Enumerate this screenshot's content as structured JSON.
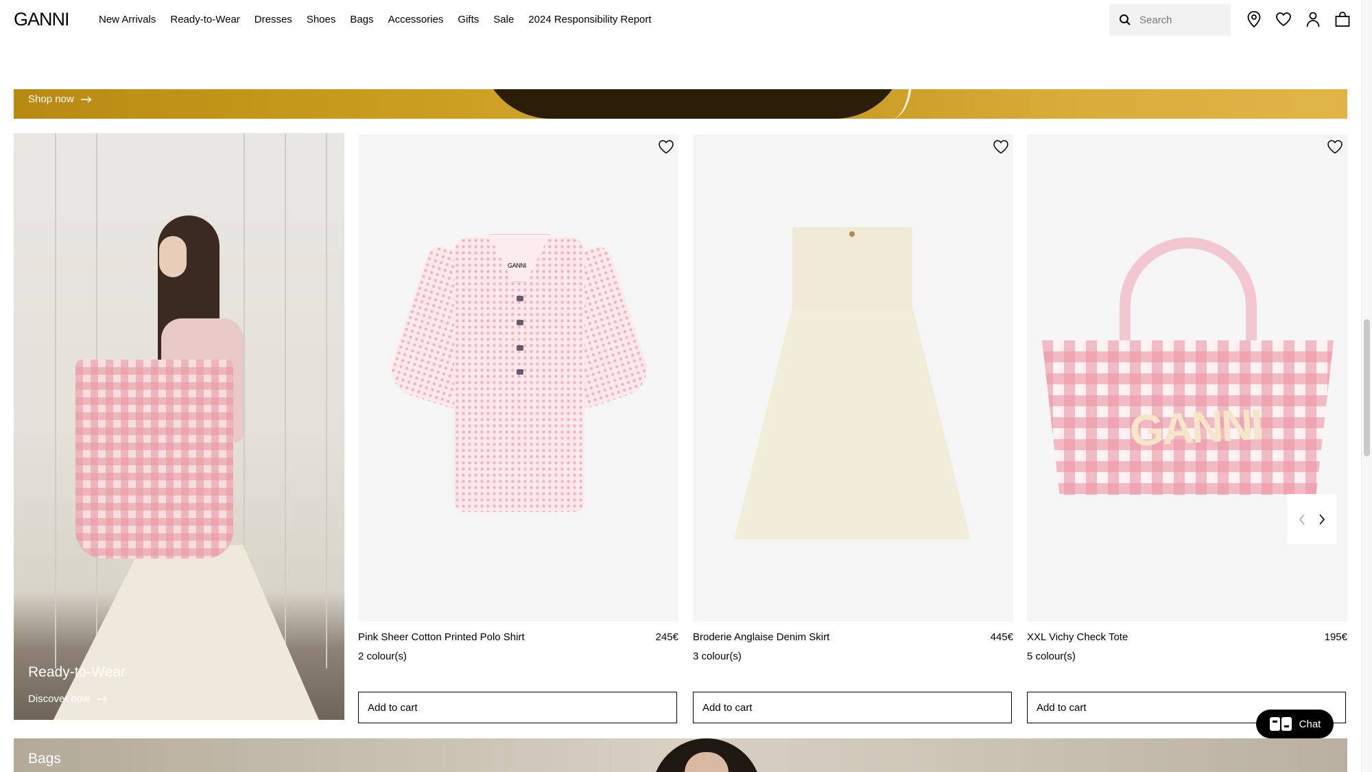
{
  "header": {
    "logo": "GANNI",
    "nav": [
      "New Arrivals",
      "Ready-to-Wear",
      "Dresses",
      "Shoes",
      "Bags",
      "Accessories",
      "Gifts",
      "Sale",
      "2024 Responsibility Report"
    ],
    "search_placeholder": "Search",
    "icons": [
      "location-icon",
      "heart-icon",
      "account-icon",
      "bag-icon"
    ]
  },
  "hero": {
    "link": "Shop now"
  },
  "feature": {
    "title": "Ready-to-Wear",
    "link": "Discover now"
  },
  "products": [
    {
      "name": "Pink Sheer Cotton Printed Polo Shirt",
      "price": "245€",
      "colours": "2 colour(s)",
      "cta": "Add to cart"
    },
    {
      "name": "Broderie Anglaise Denim Skirt",
      "price": "445€",
      "colours": "3 colour(s)",
      "cta": "Add to cart"
    },
    {
      "name": "XXL Vichy Check Tote",
      "price": "195€",
      "colours": "5 colour(s)",
      "cta": "Add to cart"
    }
  ],
  "polo_label": "GANNI",
  "tote_print": "GANNI",
  "chat": {
    "label": "Chat"
  },
  "bags": {
    "title": "Bags"
  }
}
